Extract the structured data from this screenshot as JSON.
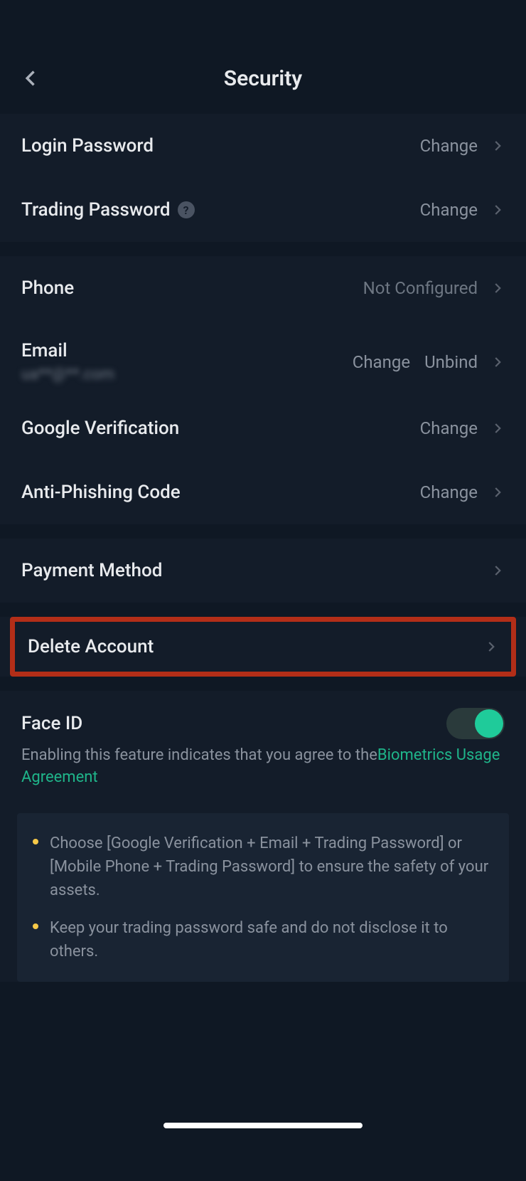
{
  "header": {
    "title": "Security"
  },
  "rows": {
    "login_password": {
      "label": "Login Password",
      "action": "Change"
    },
    "trading_password": {
      "label": "Trading Password",
      "action": "Change"
    },
    "phone": {
      "label": "Phone",
      "status": "Not Configured"
    },
    "email": {
      "label": "Email",
      "sub": "ua**@**.com",
      "action1": "Change",
      "action2": "Unbind"
    },
    "google_verification": {
      "label": "Google Verification",
      "action": "Change"
    },
    "anti_phishing": {
      "label": "Anti-Phishing Code",
      "action": "Change"
    },
    "payment_method": {
      "label": "Payment Method"
    },
    "delete_account": {
      "label": "Delete Account"
    },
    "face_id": {
      "label": "Face ID",
      "desc_prefix": "Enabling this feature indicates that you agree to the",
      "desc_link": "Biometrics Usage Agreement"
    }
  },
  "info": {
    "item1": "Choose [Google Verification + Email + Trading Password] or [Mobile Phone + Trading Password] to ensure the safety of your assets.",
    "item2": "Keep your trading password safe and do not disclose it to others."
  }
}
